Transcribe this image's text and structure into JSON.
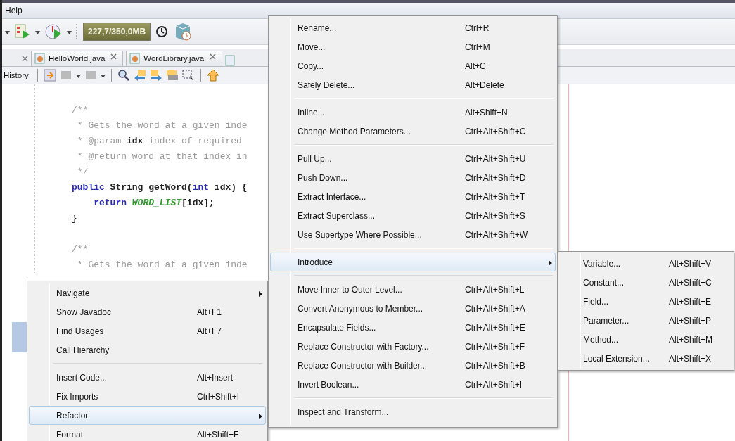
{
  "menu_bar": {
    "items": [
      "Help"
    ]
  },
  "toolbar": {
    "memory": "227,7/350,0MB"
  },
  "tabs": [
    {
      "label": "HelloWorld.java"
    },
    {
      "label": "WordLibrary.java"
    }
  ],
  "editor_toolbar": {
    "view": "History"
  },
  "code_lines": [
    {
      "kind": "code",
      "segments": [
        {
          "text": "/**",
          "kind": "comment"
        }
      ]
    },
    {
      "kind": "code",
      "segments": [
        {
          "text": " * Gets the word at a given inde",
          "kind": "comment"
        }
      ]
    },
    {
      "kind": "code",
      "segments": [
        {
          "text": " * @param ",
          "kind": "comment"
        },
        {
          "text": "idx",
          "kind": "strong"
        },
        {
          "text": " index of required",
          "kind": "comment"
        }
      ]
    },
    {
      "kind": "code",
      "segments": [
        {
          "text": " * @return word at that index in",
          "kind": "comment"
        }
      ]
    },
    {
      "kind": "code",
      "segments": [
        {
          "text": " */",
          "kind": "comment"
        }
      ]
    },
    {
      "kind": "code",
      "segments": [
        {
          "text": "public",
          "kind": "keyword"
        },
        {
          "text": " String getWord(",
          "kind": "strong"
        },
        {
          "text": "int",
          "kind": "keyword"
        },
        {
          "text": " idx) {",
          "kind": "strong"
        }
      ]
    },
    {
      "kind": "code",
      "indented": true,
      "segments": [
        {
          "text": "return",
          "kind": "keyword"
        },
        {
          "text": " WORD_LIST",
          "kind": "constant"
        },
        {
          "text": "[idx];",
          "kind": "strong"
        }
      ]
    },
    {
      "kind": "code",
      "segments": [
        {
          "text": "}",
          "kind": "plain"
        }
      ]
    },
    {
      "kind": "blank"
    },
    {
      "kind": "code",
      "segments": [
        {
          "text": "/**",
          "kind": "comment"
        }
      ]
    },
    {
      "kind": "code",
      "segments": [
        {
          "text": " * Gets the word at a given inde",
          "kind": "comment"
        }
      ]
    }
  ],
  "context_menu": {
    "items": [
      {
        "kind": "item",
        "label": "Navigate",
        "submenu": true,
        "selected": false
      },
      {
        "kind": "item",
        "label": "Show Javadoc",
        "shortcut": "Alt+F1",
        "selected": false
      },
      {
        "kind": "item",
        "label": "Find Usages",
        "shortcut": "Alt+F7",
        "selected": false
      },
      {
        "kind": "item",
        "label": "Call Hierarchy",
        "selected": false
      },
      {
        "kind": "separator"
      },
      {
        "kind": "item",
        "label": "Insert Code...",
        "shortcut": "Alt+Insert",
        "selected": false
      },
      {
        "kind": "item",
        "label": "Fix Imports",
        "shortcut": "Ctrl+Shift+I",
        "selected": false
      },
      {
        "kind": "item",
        "label": "Refactor",
        "submenu": true,
        "selected": true
      },
      {
        "kind": "item",
        "label": "Format",
        "shortcut": "Alt+Shift+F",
        "selected": false
      }
    ]
  },
  "refactor_menu": {
    "items": [
      {
        "kind": "item",
        "label": "Rename...",
        "shortcut": "Ctrl+R",
        "selected": false
      },
      {
        "kind": "item",
        "label": "Move...",
        "shortcut": "Ctrl+M",
        "selected": false
      },
      {
        "kind": "item",
        "label": "Copy...",
        "shortcut": "Alt+C",
        "selected": false
      },
      {
        "kind": "item",
        "label": "Safely Delete...",
        "shortcut": "Alt+Delete",
        "selected": false
      },
      {
        "kind": "separator"
      },
      {
        "kind": "item",
        "label": "Inline...",
        "shortcut": "Alt+Shift+N",
        "selected": false
      },
      {
        "kind": "item",
        "label": "Change Method Parameters...",
        "shortcut": "Ctrl+Alt+Shift+C",
        "selected": false
      },
      {
        "kind": "separator"
      },
      {
        "kind": "item",
        "label": "Pull Up...",
        "shortcut": "Ctrl+Alt+Shift+U",
        "selected": false
      },
      {
        "kind": "item",
        "label": "Push Down...",
        "shortcut": "Ctrl+Alt+Shift+D",
        "selected": false
      },
      {
        "kind": "item",
        "label": "Extract Interface...",
        "shortcut": "Ctrl+Alt+Shift+T",
        "selected": false
      },
      {
        "kind": "item",
        "label": "Extract Superclass...",
        "shortcut": "Ctrl+Alt+Shift+S",
        "selected": false
      },
      {
        "kind": "item",
        "label": "Use Supertype Where Possible...",
        "shortcut": "Ctrl+Alt+Shift+W",
        "selected": false
      },
      {
        "kind": "separator"
      },
      {
        "kind": "item",
        "label": "Introduce",
        "submenu": true,
        "selected": true
      },
      {
        "kind": "separator"
      },
      {
        "kind": "item",
        "label": "Move Inner to Outer Level...",
        "shortcut": "Ctrl+Alt+Shift+L",
        "selected": false
      },
      {
        "kind": "item",
        "label": "Convert Anonymous to Member...",
        "shortcut": "Ctrl+Alt+Shift+A",
        "selected": false
      },
      {
        "kind": "item",
        "label": "Encapsulate Fields...",
        "shortcut": "Ctrl+Alt+Shift+E",
        "selected": false
      },
      {
        "kind": "item",
        "label": "Replace Constructor with Factory...",
        "shortcut": "Ctrl+Alt+Shift+F",
        "selected": false
      },
      {
        "kind": "item",
        "label": "Replace Constructor with Builder...",
        "shortcut": "Ctrl+Alt+Shift+B",
        "selected": false
      },
      {
        "kind": "item",
        "label": "Invert Boolean...",
        "shortcut": "Ctrl+Alt+Shift+I",
        "selected": false
      },
      {
        "kind": "separator"
      },
      {
        "kind": "item",
        "label": "Inspect and Transform...",
        "selected": false
      }
    ]
  },
  "introduce_menu": {
    "items": [
      {
        "kind": "item",
        "label": "Variable...",
        "shortcut": "Alt+Shift+V",
        "selected": false
      },
      {
        "kind": "item",
        "label": "Constant...",
        "shortcut": "Alt+Shift+C",
        "selected": false
      },
      {
        "kind": "item",
        "label": "Field...",
        "shortcut": "Alt+Shift+E",
        "selected": false
      },
      {
        "kind": "item",
        "label": "Parameter...",
        "shortcut": "Alt+Shift+P",
        "selected": false
      },
      {
        "kind": "item",
        "label": "Method...",
        "shortcut": "Alt+Shift+M",
        "selected": false
      },
      {
        "kind": "item",
        "label": "Local Extension...",
        "shortcut": "Alt+Shift+X",
        "selected": false
      }
    ]
  }
}
